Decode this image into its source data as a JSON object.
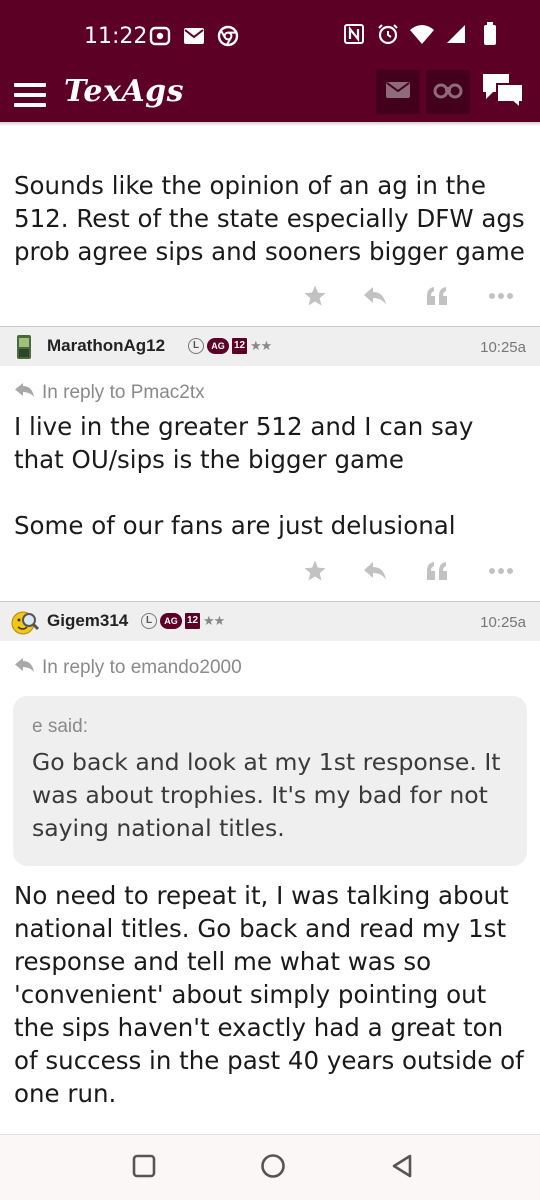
{
  "status_bar": {
    "time": "11:22",
    "left_icons": [
      "radio-icon",
      "mail-icon",
      "chrome-icon"
    ],
    "right_icons": [
      "nfc-icon",
      "alarm-icon",
      "wifi-icon",
      "signal-icon",
      "battery-icon"
    ]
  },
  "app_bar": {
    "logo": "TexAgs",
    "buttons": [
      "menu-icon",
      "mail-icon",
      "binoculars-icon",
      "chat-icon"
    ]
  },
  "colors": {
    "brand": "#5d0025",
    "badge": "#5d0025",
    "muted": "#8a8a8a",
    "quote_bg": "#efefef"
  },
  "posts": [
    {
      "body": "Sounds like the opinion of an ag in the 512. Rest of the state especially DFW ags prob agree sips and sooners bigger game"
    },
    {
      "username": "MarathonAg12",
      "avatar": "phone-avatar",
      "badges": {
        "l": "L",
        "ag": "AG",
        "twelve": "12",
        "stars": "★★"
      },
      "time": "10:25a",
      "reply_to": "In reply to Pmac2tx",
      "body": "I live in the greater 512 and I can say that OU/sips is the bigger game\n\nSome of our fans are just delusional"
    },
    {
      "username": "Gigem314",
      "avatar": "smiley-magnifier-avatar",
      "badges": {
        "l": "L",
        "ag": "AG",
        "twelve": "12",
        "stars": "★★"
      },
      "time": "10:25a",
      "reply_to": "In reply to emando2000",
      "quote": {
        "who": "e said:",
        "text": "Go back and look at my 1st response. It was about trophies. It's my bad for not saying national titles."
      },
      "body": "No need to repeat it, I was talking about national titles. Go back and read my 1st response and tell me what was so 'convenient' about simply pointing out the sips haven't exactly had a great ton of success in the past 40 years outside of one run."
    }
  ],
  "post_actions": [
    "star-icon",
    "reply-icon",
    "quote-icon",
    "more-icon"
  ],
  "nav_bar": [
    "recents-button",
    "home-button",
    "back-button"
  ]
}
